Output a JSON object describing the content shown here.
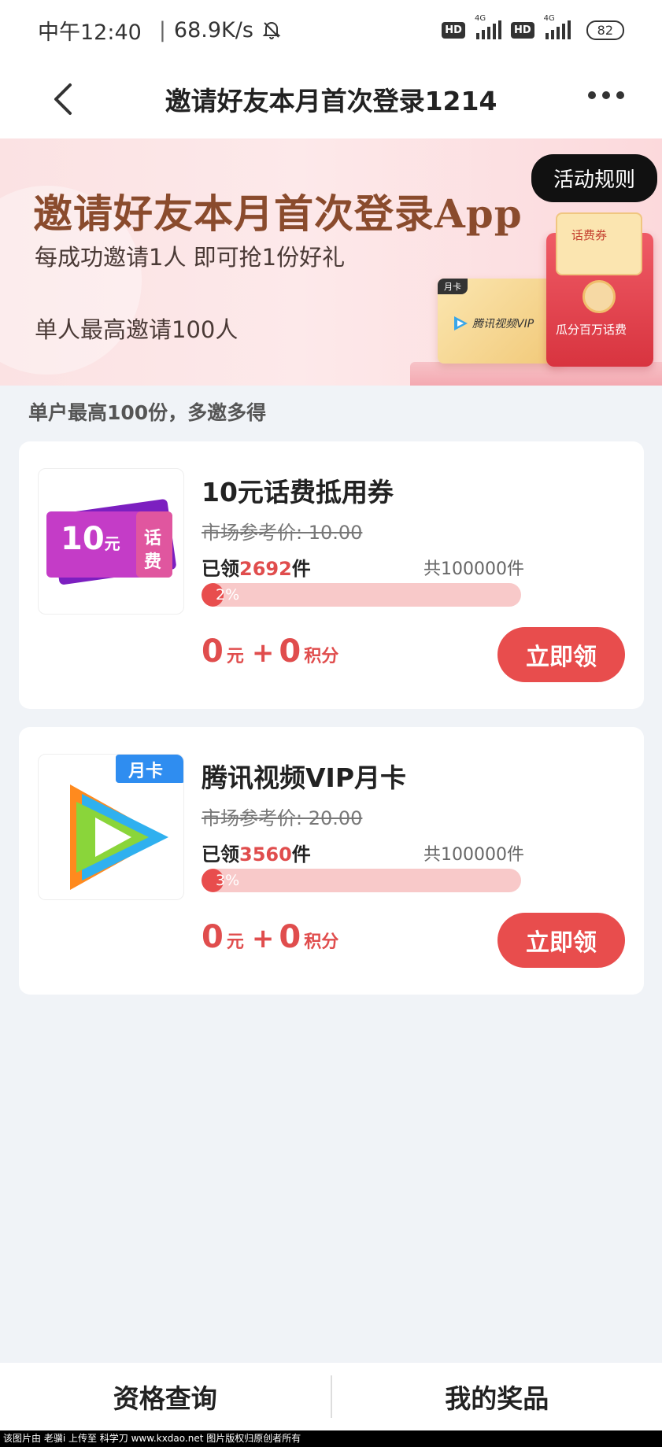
{
  "status": {
    "time": "中午12:40",
    "speed": "68.9K/s",
    "hd1": "HD",
    "net1": "4G",
    "hd2": "HD",
    "net2": "4G",
    "battery": "82"
  },
  "header": {
    "title": "邀请好友本月首次登录1214"
  },
  "banner": {
    "headline": "邀请好友本月首次登录App",
    "line1": "每成功邀请1人 即可抢1份好礼",
    "line2": "单人最高邀请100人",
    "rules_button": "活动规则",
    "vip_tag": "月卡",
    "vip_logo": "腾讯视频VIP",
    "ticket_label": "话费券",
    "envelope_caption": "瓜分百万话费"
  },
  "subheader": "单户最高100份，多邀多得",
  "items": [
    {
      "thumb_value": "10",
      "thumb_unit": "元",
      "thumb_label_top": "话",
      "thumb_label_bottom": "费",
      "name": "10元话费抵用券",
      "market_price": "市场参考价: 10.00",
      "claimed_prefix": "已领",
      "claimed_count": "2692",
      "claimed_suffix": "件",
      "total": "共100000件",
      "progress_text": "2%",
      "progress": 0.02,
      "cost_money": "0",
      "cost_money_unit": "元",
      "plus": "+",
      "cost_points": "0",
      "cost_points_unit": "积分",
      "button": "立即领"
    },
    {
      "thumb_tag": "月卡",
      "name": "腾讯视频VIP月卡",
      "market_price": "市场参考价: 20.00",
      "claimed_prefix": "已领",
      "claimed_count": "3560",
      "claimed_suffix": "件",
      "total": "共100000件",
      "progress_text": "3%",
      "progress": 0.03,
      "cost_money": "0",
      "cost_money_unit": "元",
      "plus": "+",
      "cost_points": "0",
      "cost_points_unit": "积分",
      "button": "立即领"
    }
  ],
  "tabs": {
    "left": "资格查询",
    "right": "我的奖品"
  },
  "watermark": "该图片由 老骥i 上传至 科学刀 www.kxdao.net 图片版权归原创者所有",
  "colors": {
    "accent": "#e84d4d",
    "progress_bg": "#f8c9c9",
    "page_bg": "#f0f3f7"
  }
}
